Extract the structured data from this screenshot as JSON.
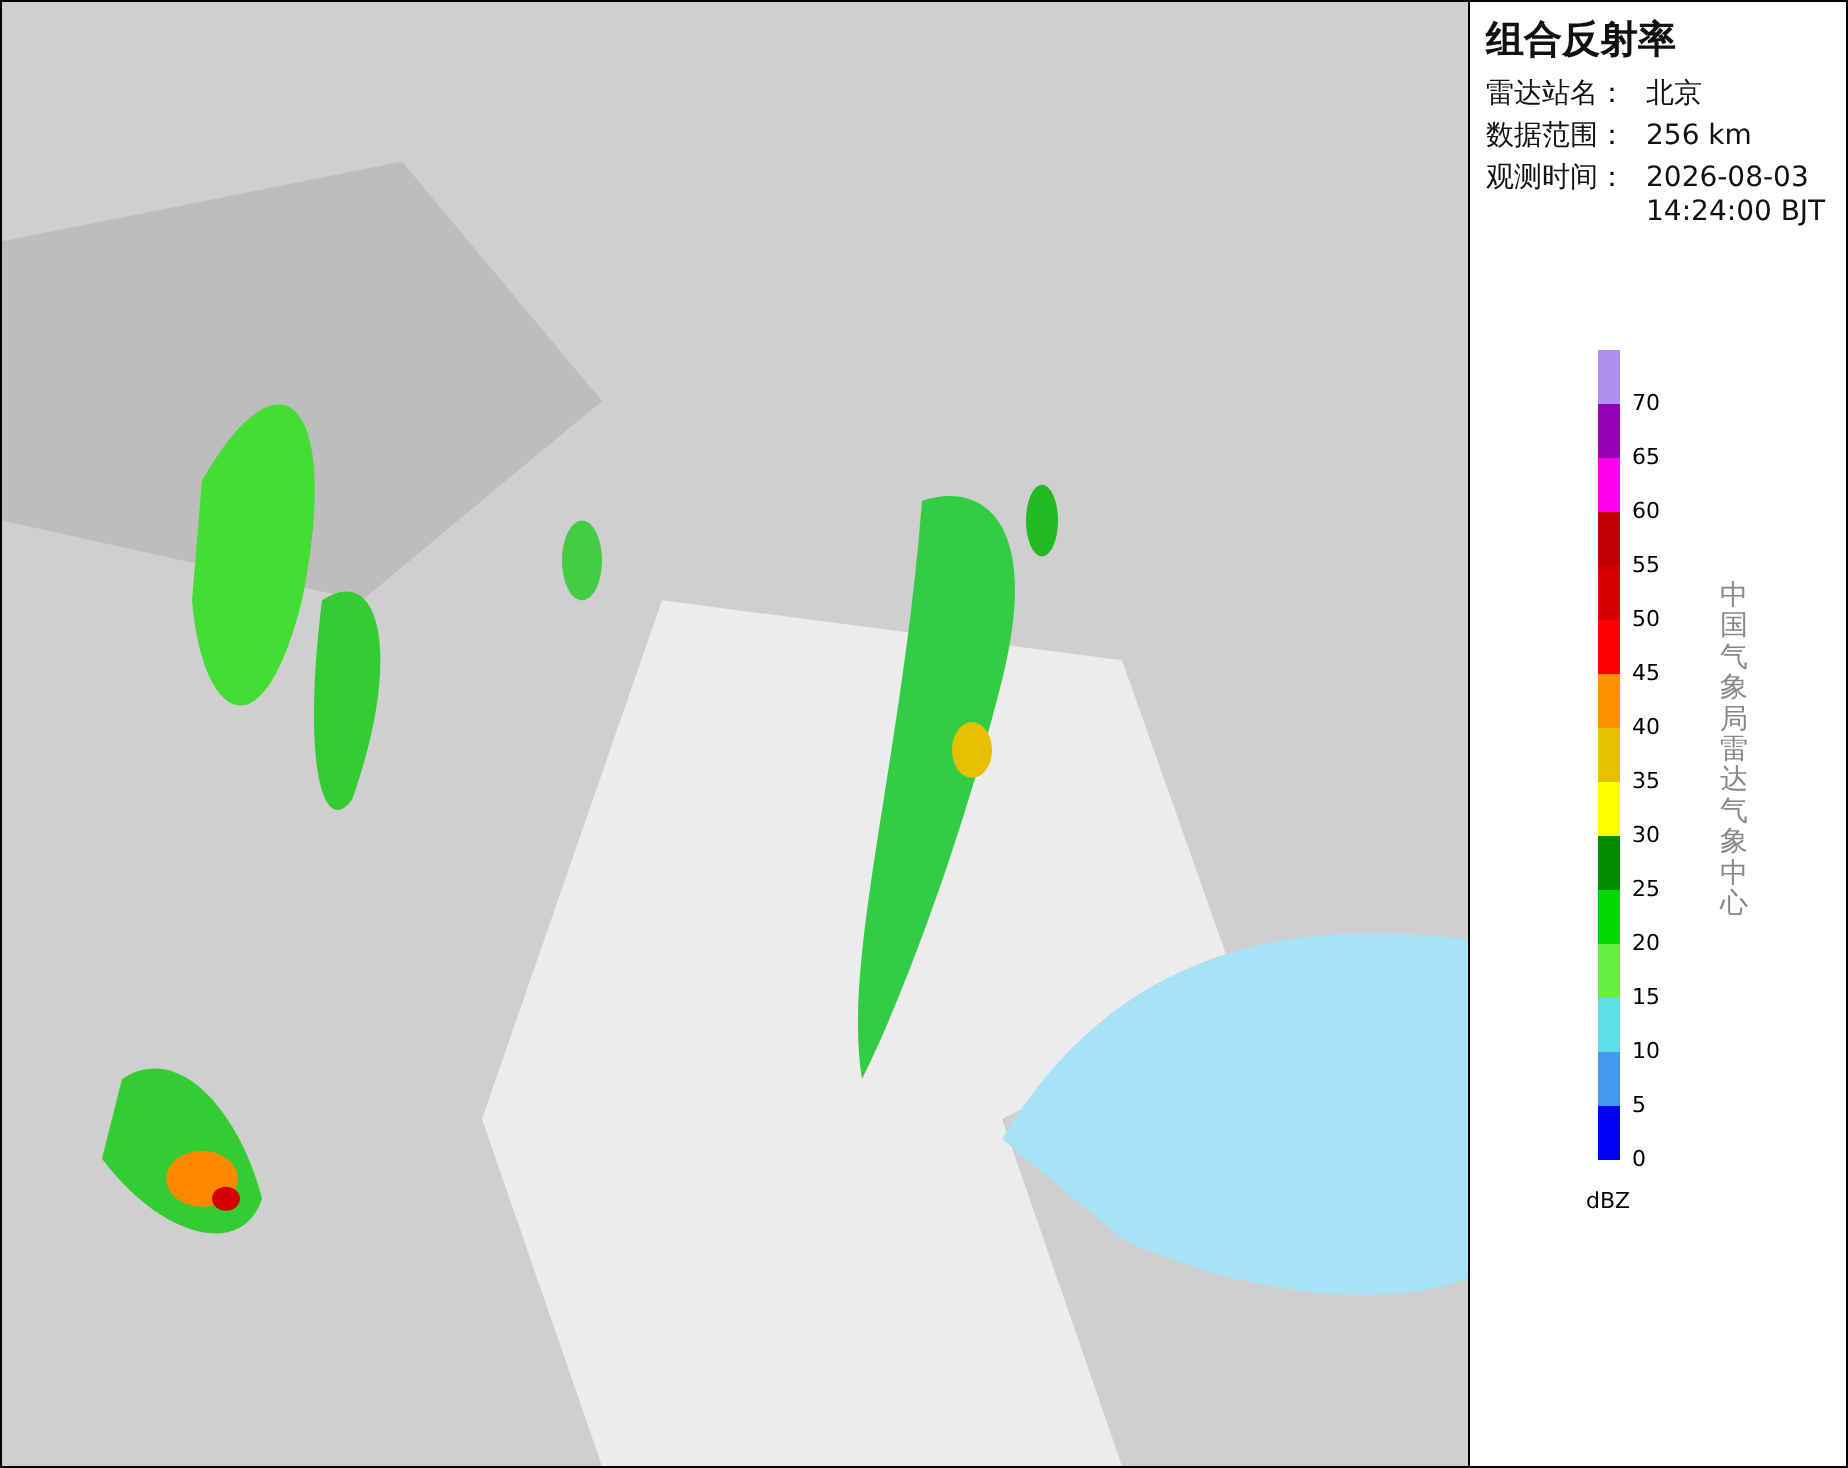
{
  "panel": {
    "title": "组合反射率",
    "info": [
      {
        "label": "雷达站名：",
        "value": "北京"
      },
      {
        "label": "数据范围：",
        "value": "256 km"
      },
      {
        "label": "观测时间：",
        "value": "2026-08-03 14:24:00 BJT"
      }
    ],
    "legend": {
      "items": [
        {
          "label": "70",
          "color": "#ad90f0"
        },
        {
          "label": "65",
          "color": "#9600b4"
        },
        {
          "label": "60",
          "color": "#ff00f0"
        },
        {
          "label": "55",
          "color": "#c00000"
        },
        {
          "label": "50",
          "color": "#d60000"
        },
        {
          "label": "45",
          "color": "#ff0000"
        },
        {
          "label": "40",
          "color": "#ff9000"
        },
        {
          "label": "35",
          "color": "#e7c000"
        },
        {
          "label": "30",
          "color": "#ffff00"
        },
        {
          "label": "25",
          "color": "#008c00"
        },
        {
          "label": "20",
          "color": "#00d800"
        },
        {
          "label": "15",
          "color": "#66ee44"
        },
        {
          "label": "10",
          "color": "#5ee0e8"
        },
        {
          "label": "5",
          "color": "#4499ee"
        },
        {
          "label": "0",
          "color": "#0000f6"
        }
      ],
      "unit": "dBZ"
    },
    "credit": "中国气象局雷达气象中心"
  }
}
